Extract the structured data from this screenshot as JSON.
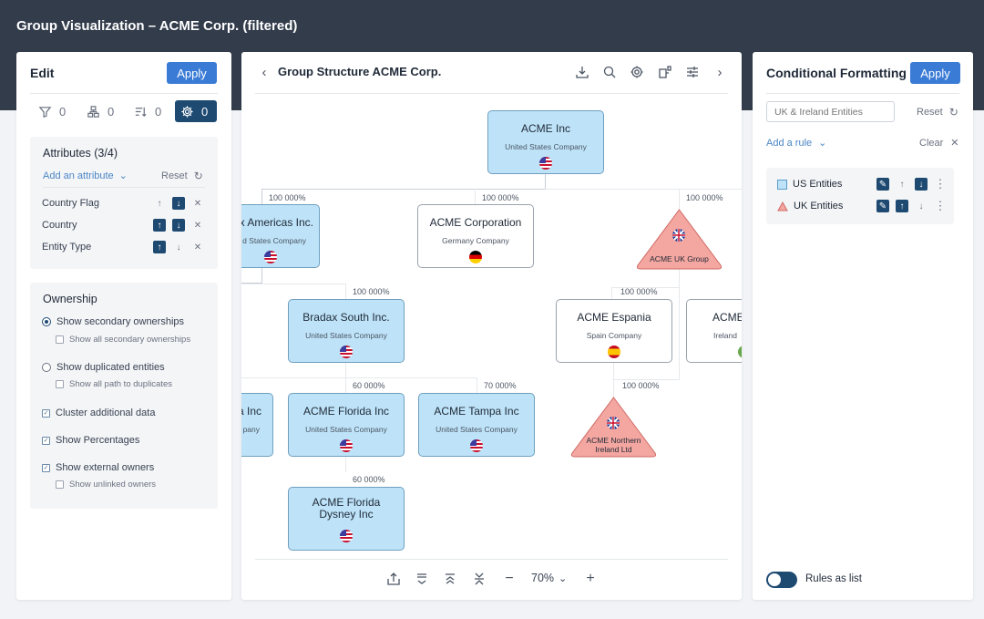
{
  "app": {
    "title": "Group Visualization – ACME Corp. (filtered)"
  },
  "edit_panel": {
    "title": "Edit",
    "apply_label": "Apply",
    "tabs": [
      {
        "icon": "filter-icon",
        "count": "0"
      },
      {
        "icon": "hierarchy-icon",
        "count": "0"
      },
      {
        "icon": "sort-icon",
        "count": "0"
      },
      {
        "icon": "gear-icon",
        "count": "0",
        "active": true
      }
    ],
    "attributes": {
      "title": "Attributes (3/4)",
      "add_label": "Add an attribute",
      "reset_label": "Reset",
      "items": [
        {
          "label": "Country Flag",
          "up_active": false,
          "down_active": true
        },
        {
          "label": "Country",
          "up_active": true,
          "down_active": true
        },
        {
          "label": "Entity Type",
          "up_active": true,
          "down_active": false
        }
      ]
    },
    "ownership": {
      "title": "Ownership",
      "options": [
        {
          "type": "radio",
          "label": "Show secondary ownerships",
          "checked": true
        },
        {
          "type": "subcheck",
          "label": "Show all secondary ownerships",
          "checked": false
        },
        {
          "type": "radio",
          "label": "Show duplicated entities",
          "checked": false
        },
        {
          "type": "subcheck",
          "label": "Show all path to duplicates",
          "checked": false
        },
        {
          "type": "check",
          "label": "Cluster additional data",
          "checked": true
        },
        {
          "type": "check",
          "label": "Show Percentages",
          "checked": true
        },
        {
          "type": "check",
          "label": "Show external owners",
          "checked": true
        },
        {
          "type": "subcheck",
          "label": "Show unlinked owners",
          "checked": false
        }
      ]
    }
  },
  "graph_panel": {
    "title": "Group Structure ACME Corp.",
    "toolbar_icons": [
      "download-icon",
      "search-icon",
      "gear-icon",
      "layout-icon",
      "sliders-icon",
      "chevron-right-icon"
    ],
    "zoom_level": "70%",
    "nodes": [
      {
        "id": "acme-inc",
        "name": "ACME Inc",
        "sub": "United States Company",
        "flag": "us",
        "shape": "box",
        "style": "us"
      },
      {
        "id": "americas",
        "name": "Bradax Americas Inc.",
        "display": "x Americas Inc.",
        "sub": "d States Company",
        "flag": "us",
        "shape": "box",
        "style": "us"
      },
      {
        "id": "acme-corp",
        "name": "ACME Corporation",
        "sub": "Germany Company",
        "flag": "de",
        "shape": "box",
        "style": "plain"
      },
      {
        "id": "uk-group",
        "name": "ACME UK Group",
        "flag": "uk",
        "shape": "triangle",
        "style": "uk"
      },
      {
        "id": "bradax-south",
        "name": "Bradax South Inc.",
        "sub": "United States Company",
        "flag": "us",
        "shape": "box",
        "style": "us"
      },
      {
        "id": "espania",
        "name": "ACME Espania",
        "sub": "Spain Company",
        "flag": "es",
        "shape": "box",
        "style": "plain"
      },
      {
        "id": "ireland",
        "name": "ACME",
        "sub": "Ireland",
        "flag": "ie",
        "shape": "box",
        "style": "plain"
      },
      {
        "id": "left-cut",
        "name": "a Inc",
        "sub": "pany",
        "shape": "box",
        "style": "us"
      },
      {
        "id": "florida",
        "name": "ACME Florida Inc",
        "sub": "United States Company",
        "flag": "us",
        "shape": "box",
        "style": "us"
      },
      {
        "id": "tampa",
        "name": "ACME Tampa Inc",
        "sub": "United States Company",
        "flag": "us",
        "shape": "box",
        "style": "us"
      },
      {
        "id": "ni",
        "name": "ACME Northern Ireland Ltd",
        "line1": "ACME Northern",
        "line2": "Ireland Ltd",
        "flag": "uk",
        "shape": "triangle",
        "style": "uk"
      },
      {
        "id": "dysney",
        "name": "ACME Florida Dysney Inc",
        "line1": "ACME Florida",
        "line2": "Dysney Inc",
        "flag": "us",
        "shape": "box",
        "style": "us"
      }
    ],
    "percentages": {
      "americas": "100 000%",
      "acme_corp": "100 000%",
      "uk_group": "100 000%",
      "bradax_south": "100 000%",
      "espania": "100 000%",
      "florida": "60 000%",
      "tampa": "70 000%",
      "ni": "100 000%",
      "dysney": "60 000%"
    }
  },
  "cf_panel": {
    "title": "Conditional Formatting",
    "apply_label": "Apply",
    "name_input_placeholder": "UK & Ireland Entities",
    "reset_label": "Reset",
    "add_rule_label": "Add a rule",
    "clear_label": "Clear",
    "rules": [
      {
        "label": "US Entities",
        "shape": "square",
        "color": "#bee3f8",
        "up_active": false,
        "down_active": true
      },
      {
        "label": "UK Entities",
        "shape": "triangle",
        "color": "#f4a6a0",
        "up_active": true,
        "down_active": false
      }
    ],
    "rules_as_list_label": "Rules as list",
    "rules_as_list_on": true
  },
  "colors": {
    "header_bg": "#323c4b",
    "accent": "#3a7bd5",
    "active_dark": "#1e4a72",
    "us_node": "#bee3f8",
    "uk_node": "#f4a6a0"
  }
}
